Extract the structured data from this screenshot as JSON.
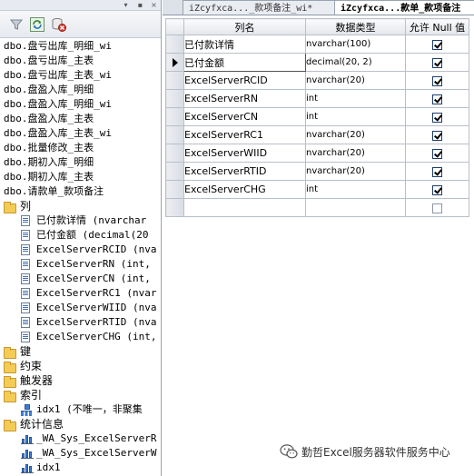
{
  "explorer": {
    "tree": [
      {
        "label": "dbo.盘亏出库_明细_wi",
        "kind": "table",
        "indent": 0
      },
      {
        "label": "dbo.盘亏出库_主表",
        "kind": "table",
        "indent": 0
      },
      {
        "label": "dbo.盘亏出库_主表_wi",
        "kind": "table",
        "indent": 0
      },
      {
        "label": "dbo.盘盈入库_明细",
        "kind": "table",
        "indent": 0
      },
      {
        "label": "dbo.盘盈入库_明细_wi",
        "kind": "table",
        "indent": 0
      },
      {
        "label": "dbo.盘盈入库_主表",
        "kind": "table",
        "indent": 0
      },
      {
        "label": "dbo.盘盈入库_主表_wi",
        "kind": "table",
        "indent": 0
      },
      {
        "label": "dbo.批量修改_主表",
        "kind": "table",
        "indent": 0
      },
      {
        "label": "dbo.期初入库_明细",
        "kind": "table",
        "indent": 0
      },
      {
        "label": "dbo.期初入库_主表",
        "kind": "table",
        "indent": 0
      },
      {
        "label": "dbo.请款单_款项备注",
        "kind": "table",
        "indent": 0
      },
      {
        "label": "列",
        "kind": "folder",
        "indent": 0
      },
      {
        "label": "已付款详情 (nvarchar",
        "kind": "column",
        "indent": 1
      },
      {
        "label": "已付金额 (decimal(20",
        "kind": "column",
        "indent": 1
      },
      {
        "label": "ExcelServerRCID (nva",
        "kind": "column",
        "indent": 1
      },
      {
        "label": "ExcelServerRN (int,",
        "kind": "column",
        "indent": 1
      },
      {
        "label": "ExcelServerCN (int,",
        "kind": "column",
        "indent": 1
      },
      {
        "label": "ExcelServerRC1 (nvar",
        "kind": "column",
        "indent": 1
      },
      {
        "label": "ExcelServerWIID (nva",
        "kind": "column",
        "indent": 1
      },
      {
        "label": "ExcelServerRTID (nva",
        "kind": "column",
        "indent": 1
      },
      {
        "label": "ExcelServerCHG (int,",
        "kind": "column",
        "indent": 1
      },
      {
        "label": "键",
        "kind": "folder",
        "indent": 0
      },
      {
        "label": "约束",
        "kind": "folder",
        "indent": 0
      },
      {
        "label": "触发器",
        "kind": "folder",
        "indent": 0
      },
      {
        "label": "索引",
        "kind": "folder",
        "indent": 0
      },
      {
        "label": "idx1 (不唯一，非聚集",
        "kind": "index",
        "indent": 1
      },
      {
        "label": "统计信息",
        "kind": "folder",
        "indent": 0
      },
      {
        "label": "_WA_Sys_ExcelServerR",
        "kind": "stat",
        "indent": 1
      },
      {
        "label": "_WA_Sys_ExcelServerW",
        "kind": "stat",
        "indent": 1
      },
      {
        "label": "idx1",
        "kind": "stat",
        "indent": 1
      }
    ]
  },
  "tabs": [
    {
      "label": "iZcyfxca..._款项备注_wi*",
      "active": false
    },
    {
      "label": "iZcyfxca...款单_款项备注",
      "active": true
    }
  ],
  "grid": {
    "headers": [
      "列名",
      "数据类型",
      "允许 Null 值"
    ],
    "rows": [
      {
        "name": "已付款详情",
        "type": "nvarchar(100)",
        "allow_null": true,
        "current": false
      },
      {
        "name": "已付金额",
        "type": "decimal(20, 2)",
        "allow_null": true,
        "current": true
      },
      {
        "name": "ExcelServerRCID",
        "type": "nvarchar(20)",
        "allow_null": true,
        "current": false
      },
      {
        "name": "ExcelServerRN",
        "type": "int",
        "allow_null": true,
        "current": false
      },
      {
        "name": "ExcelServerCN",
        "type": "int",
        "allow_null": true,
        "current": false
      },
      {
        "name": "ExcelServerRC1",
        "type": "nvarchar(20)",
        "allow_null": true,
        "current": false
      },
      {
        "name": "ExcelServerWIID",
        "type": "nvarchar(20)",
        "allow_null": true,
        "current": false
      },
      {
        "name": "ExcelServerRTID",
        "type": "nvarchar(20)",
        "allow_null": true,
        "current": false
      },
      {
        "name": "ExcelServerCHG",
        "type": "int",
        "allow_null": true,
        "current": false
      },
      {
        "name": "",
        "type": "",
        "allow_null": false,
        "current": false
      }
    ]
  },
  "watermark": {
    "text": "勤哲Excel服务器软件服务中心"
  }
}
